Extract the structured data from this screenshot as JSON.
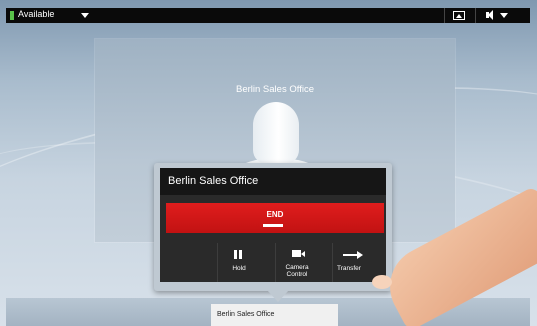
{
  "status_bar": {
    "presence": "Available",
    "presence_color": "#59c24a",
    "icons": [
      "dropdown-caret-icon",
      "selfview-image-icon",
      "volume-icon",
      "dropdown-caret-icon"
    ]
  },
  "video": {
    "remote_name": "Berlin Sales Office"
  },
  "call_popup": {
    "title": "Berlin Sales Office",
    "end_label": "END",
    "end_color": "#d61818",
    "actions": [
      {
        "label": "Hold",
        "icon": "pause-icon"
      },
      {
        "label": "Camera\nControl",
        "icon": "camera-icon"
      },
      {
        "label": "Transfer",
        "icon": "transfer-arrow-icon"
      }
    ]
  },
  "bottom_bar": {
    "caller": "Berlin Sales Office"
  }
}
